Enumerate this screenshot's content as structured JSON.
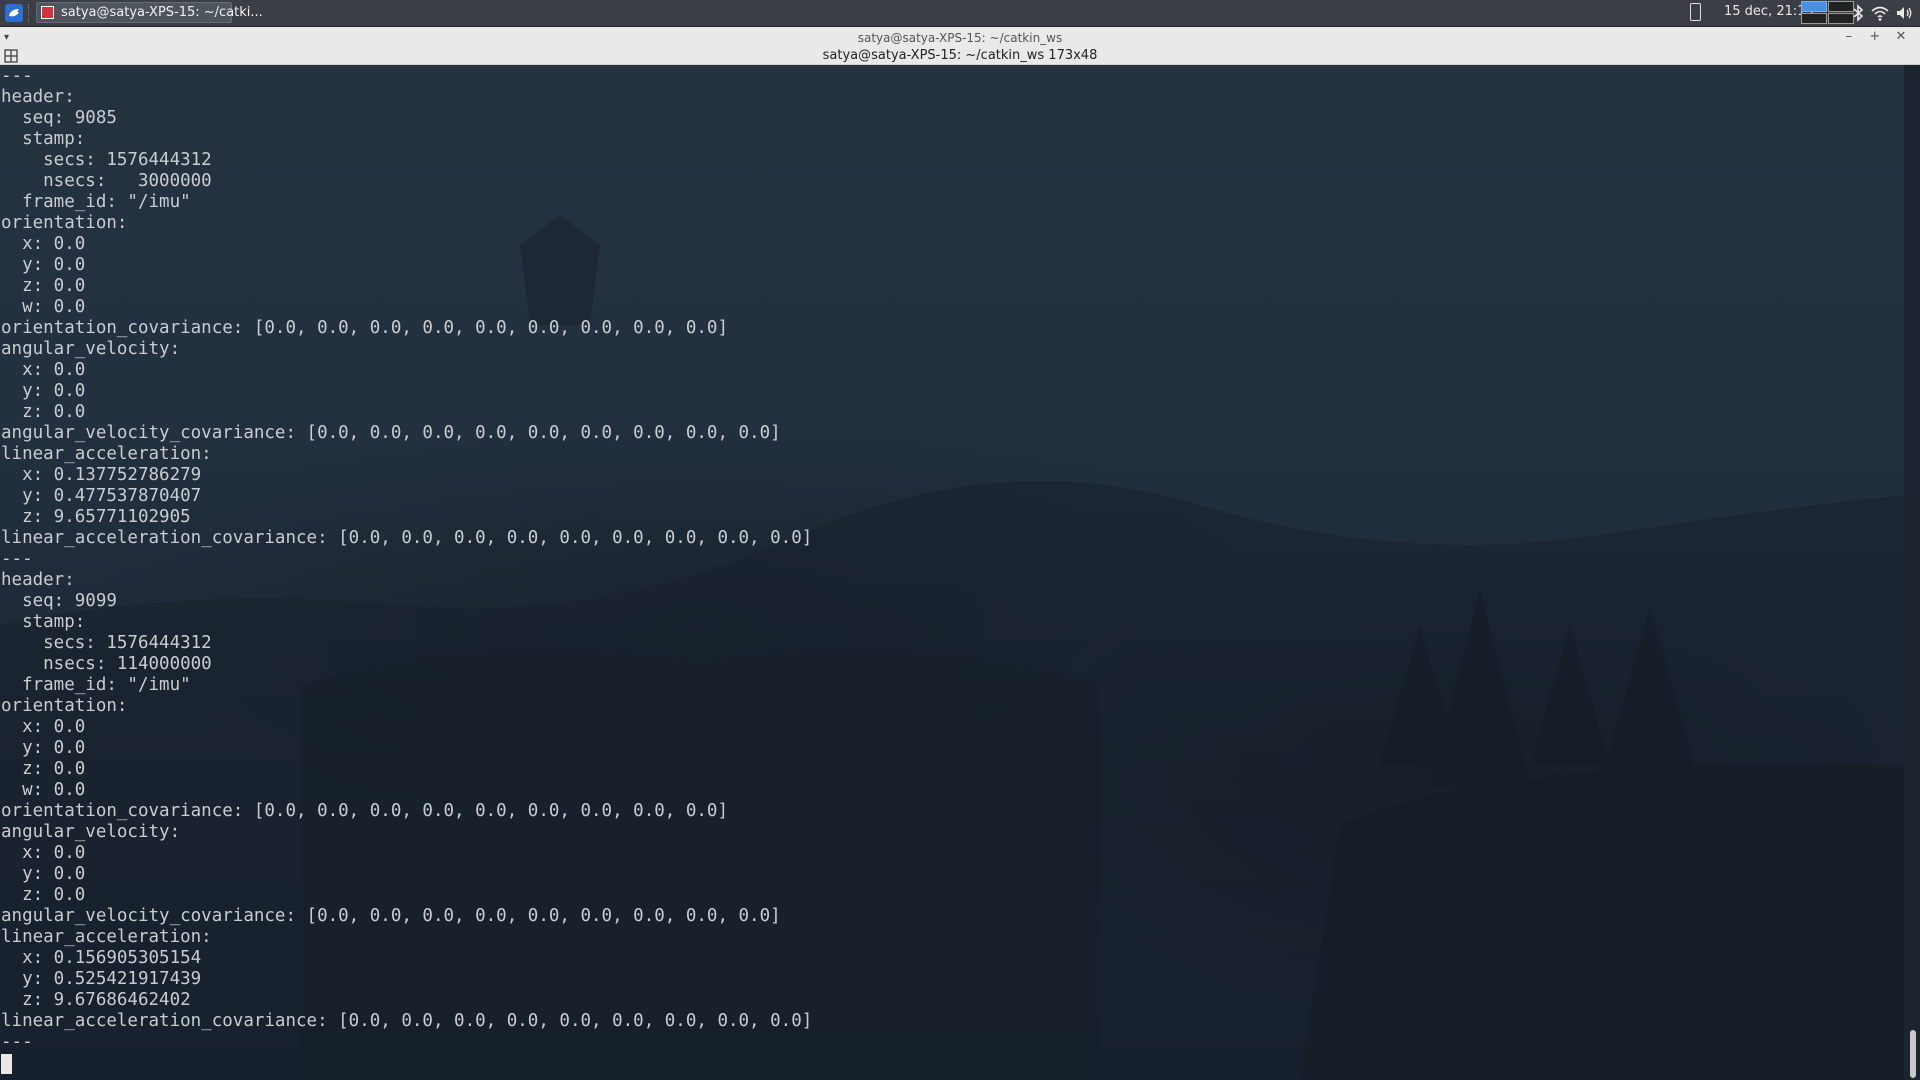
{
  "panel": {
    "task_label": "satya@satya-XPS-15: ~/catki...",
    "clock": "15 dec, 21:19"
  },
  "window": {
    "title": "satya@satya-XPS-15: ~/catkin_ws",
    "tab_title": "satya@satya-XPS-15: ~/catkin_ws 173x48",
    "menu_glyph": "▾",
    "controls": {
      "minimize": "–",
      "maximize": "+",
      "close": "✕"
    }
  },
  "terminal": {
    "lines": [
      "---",
      "header:",
      "  seq: 9085",
      "  stamp:",
      "    secs: 1576444312",
      "    nsecs:   3000000",
      "  frame_id: \"/imu\"",
      "orientation:",
      "  x: 0.0",
      "  y: 0.0",
      "  z: 0.0",
      "  w: 0.0",
      "orientation_covariance: [0.0, 0.0, 0.0, 0.0, 0.0, 0.0, 0.0, 0.0, 0.0]",
      "angular_velocity:",
      "  x: 0.0",
      "  y: 0.0",
      "  z: 0.0",
      "angular_velocity_covariance: [0.0, 0.0, 0.0, 0.0, 0.0, 0.0, 0.0, 0.0, 0.0]",
      "linear_acceleration:",
      "  x: 0.137752786279",
      "  y: 0.477537870407",
      "  z: 9.65771102905",
      "linear_acceleration_covariance: [0.0, 0.0, 0.0, 0.0, 0.0, 0.0, 0.0, 0.0, 0.0]",
      "---",
      "header:",
      "  seq: 9099",
      "  stamp:",
      "    secs: 1576444312",
      "    nsecs: 114000000",
      "  frame_id: \"/imu\"",
      "orientation:",
      "  x: 0.0",
      "  y: 0.0",
      "  z: 0.0",
      "  w: 0.0",
      "orientation_covariance: [0.0, 0.0, 0.0, 0.0, 0.0, 0.0, 0.0, 0.0, 0.0]",
      "angular_velocity:",
      "  x: 0.0",
      "  y: 0.0",
      "  z: 0.0",
      "angular_velocity_covariance: [0.0, 0.0, 0.0, 0.0, 0.0, 0.0, 0.0, 0.0, 0.0]",
      "linear_acceleration:",
      "  x: 0.156905305154",
      "  y: 0.525421917439",
      "  z: 9.67686462402",
      "linear_acceleration_covariance: [0.0, 0.0, 0.0, 0.0, 0.0, 0.0, 0.0, 0.0, 0.0]",
      "---"
    ]
  },
  "icons": {
    "menu": "app-menu-icon",
    "task": "terminal-app-icon",
    "battery": "battery-icon",
    "bluetooth": "bluetooth-icon",
    "wifi": "wifi-icon",
    "volume": "volume-icon",
    "tab": "tab-icon"
  },
  "colors": {
    "panel_bg": "#3b3f45",
    "titlebar_bg": "#e9e9e7",
    "terminal_fg": "#c9ccd0",
    "terminal_bg": "#1f2a36",
    "workspace_active": "#4b8fe0"
  }
}
